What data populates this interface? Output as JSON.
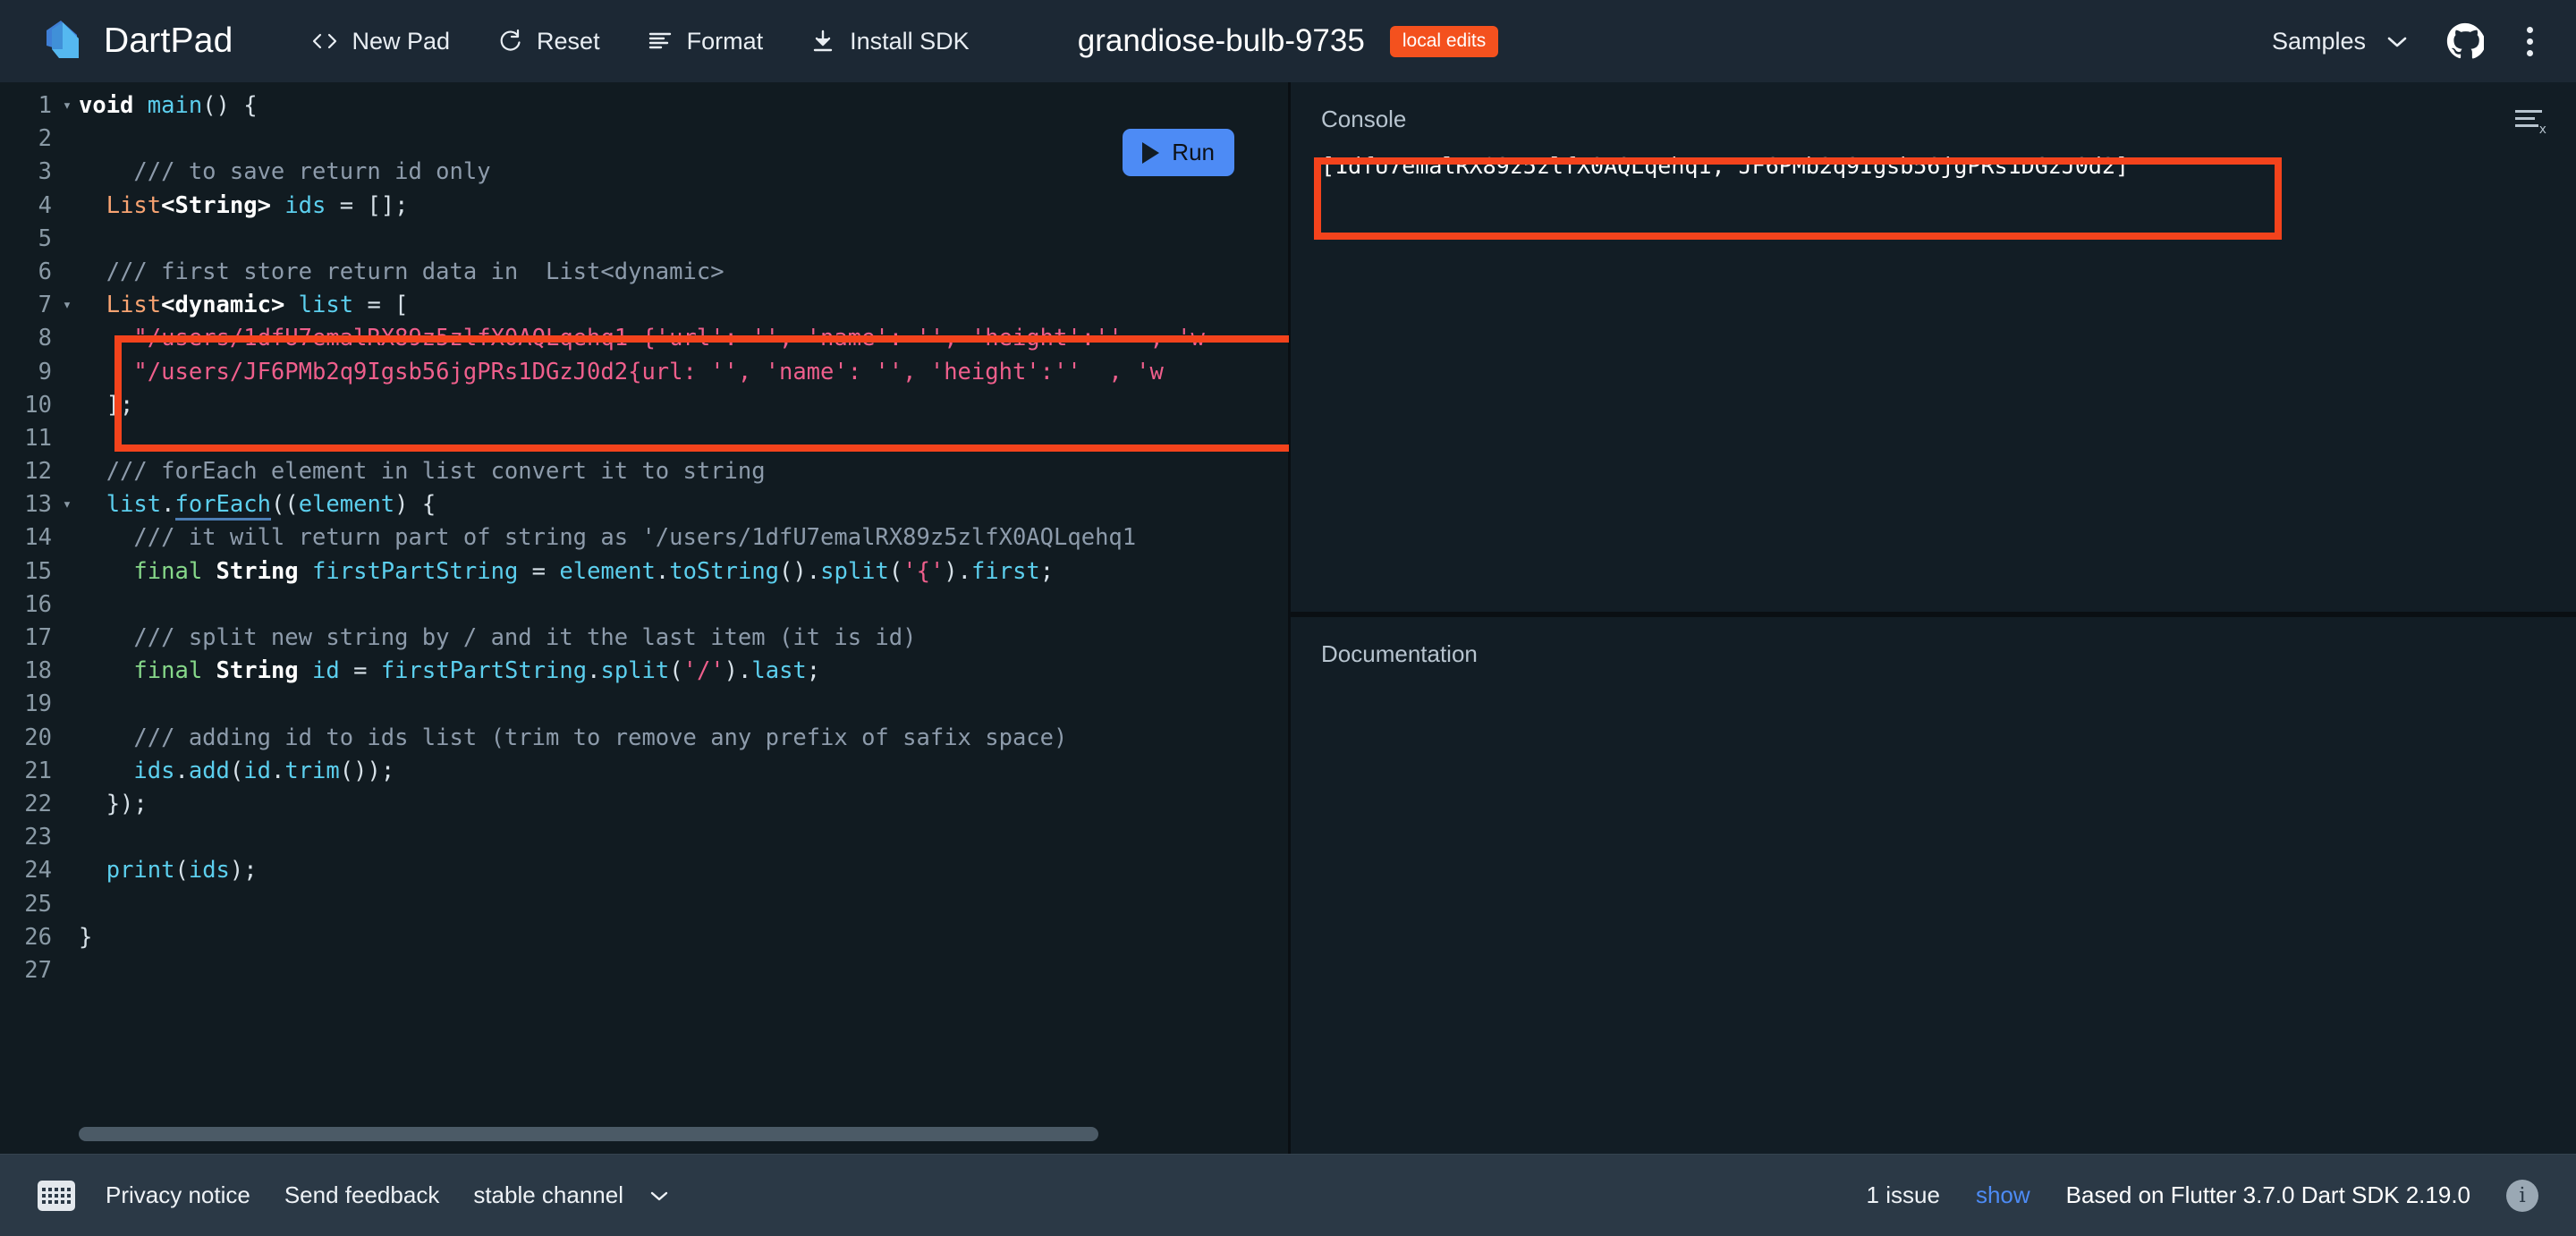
{
  "header": {
    "brand": "DartPad",
    "actions": [
      {
        "label": "New Pad",
        "icon": "code-brackets-icon"
      },
      {
        "label": "Reset",
        "icon": "reset-icon"
      },
      {
        "label": "Format",
        "icon": "format-lines-icon"
      },
      {
        "label": "Install SDK",
        "icon": "download-icon"
      }
    ],
    "pad_title": "grandiose-bulb-9735",
    "badge": "local edits",
    "samples_label": "Samples",
    "github_icon": "github-icon",
    "more_icon": "kebab-menu-icon"
  },
  "editor": {
    "run_label": "Run",
    "lines": [
      {
        "n": "1",
        "fold": "▾",
        "tokens": [
          {
            "t": "kw",
            "s": "void"
          },
          {
            "t": "punc",
            "s": " "
          },
          {
            "t": "ident",
            "s": "main"
          },
          {
            "t": "punc",
            "s": "() {"
          }
        ]
      },
      {
        "n": "2",
        "fold": "",
        "tokens": []
      },
      {
        "n": "3",
        "fold": "",
        "tokens": [
          {
            "t": "cmt",
            "s": "    /// to save return id only"
          }
        ]
      },
      {
        "n": "4",
        "fold": "",
        "tokens": [
          {
            "t": "punc",
            "s": "  "
          },
          {
            "t": "type",
            "s": "List"
          },
          {
            "t": "typew",
            "s": "<String>"
          },
          {
            "t": "punc",
            "s": " "
          },
          {
            "t": "var",
            "s": "ids"
          },
          {
            "t": "punc",
            "s": " = [];"
          }
        ]
      },
      {
        "n": "5",
        "fold": "",
        "tokens": []
      },
      {
        "n": "6",
        "fold": "",
        "tokens": [
          {
            "t": "cmt",
            "s": "  /// first store return data in  List<dynamic>"
          }
        ]
      },
      {
        "n": "7",
        "fold": "▾",
        "tokens": [
          {
            "t": "punc",
            "s": "  "
          },
          {
            "t": "type",
            "s": "List"
          },
          {
            "t": "typew",
            "s": "<dynamic>"
          },
          {
            "t": "punc",
            "s": " "
          },
          {
            "t": "var",
            "s": "list"
          },
          {
            "t": "punc",
            "s": " = ["
          }
        ]
      },
      {
        "n": "8",
        "fold": "",
        "tokens": [
          {
            "t": "str",
            "s": "    \"/users/1dfU7emalRX89z5zlfX0AQLqehq1 {'url': '', 'name': '', 'height':''  , 'w"
          }
        ]
      },
      {
        "n": "9",
        "fold": "",
        "tokens": [
          {
            "t": "str",
            "s": "    \"/users/JF6PMb2q9Igsb56jgPRs1DGzJ0d2{url: '', 'name': '', 'height':''  , 'w"
          }
        ]
      },
      {
        "n": "10",
        "fold": "",
        "tokens": [
          {
            "t": "punc",
            "s": "  ];"
          }
        ]
      },
      {
        "n": "11",
        "fold": "",
        "tokens": []
      },
      {
        "n": "12",
        "fold": "",
        "tokens": [
          {
            "t": "cmt",
            "s": "  /// forEach element in list convert it to string"
          }
        ]
      },
      {
        "n": "13",
        "fold": "▾",
        "tokens": [
          {
            "t": "punc",
            "s": "  "
          },
          {
            "t": "var",
            "s": "list"
          },
          {
            "t": "punc",
            "s": "."
          },
          {
            "t": "link",
            "s": "forEach"
          },
          {
            "t": "punc",
            "s": "(("
          },
          {
            "t": "var",
            "s": "element"
          },
          {
            "t": "punc",
            "s": ") {"
          }
        ]
      },
      {
        "n": "14",
        "fold": "",
        "tokens": [
          {
            "t": "cmt",
            "s": "    /// it will return part of string as '/users/1dfU7emalRX89z5zlfX0AQLqehq1"
          }
        ]
      },
      {
        "n": "15",
        "fold": "",
        "tokens": [
          {
            "t": "punc",
            "s": "    "
          },
          {
            "t": "final",
            "s": "final"
          },
          {
            "t": "punc",
            "s": " "
          },
          {
            "t": "typew",
            "s": "String"
          },
          {
            "t": "punc",
            "s": " "
          },
          {
            "t": "var",
            "s": "firstPartString"
          },
          {
            "t": "punc",
            "s": " = "
          },
          {
            "t": "var",
            "s": "element"
          },
          {
            "t": "punc",
            "s": "."
          },
          {
            "t": "ident",
            "s": "toString"
          },
          {
            "t": "punc",
            "s": "()."
          },
          {
            "t": "ident",
            "s": "split"
          },
          {
            "t": "punc",
            "s": "("
          },
          {
            "t": "str",
            "s": "'{'"
          },
          {
            "t": "punc",
            "s": ")."
          },
          {
            "t": "ident",
            "s": "first"
          },
          {
            "t": "punc",
            "s": ";"
          }
        ]
      },
      {
        "n": "16",
        "fold": "",
        "tokens": []
      },
      {
        "n": "17",
        "fold": "",
        "tokens": [
          {
            "t": "cmt",
            "s": "    /// split new string by / and it the last item (it is id)"
          }
        ]
      },
      {
        "n": "18",
        "fold": "",
        "tokens": [
          {
            "t": "punc",
            "s": "    "
          },
          {
            "t": "final",
            "s": "final"
          },
          {
            "t": "punc",
            "s": " "
          },
          {
            "t": "typew",
            "s": "String"
          },
          {
            "t": "punc",
            "s": " "
          },
          {
            "t": "var",
            "s": "id"
          },
          {
            "t": "punc",
            "s": " = "
          },
          {
            "t": "var",
            "s": "firstPartString"
          },
          {
            "t": "punc",
            "s": "."
          },
          {
            "t": "ident",
            "s": "split"
          },
          {
            "t": "punc",
            "s": "("
          },
          {
            "t": "str",
            "s": "'/'"
          },
          {
            "t": "punc",
            "s": ")."
          },
          {
            "t": "ident",
            "s": "last"
          },
          {
            "t": "punc",
            "s": ";"
          }
        ]
      },
      {
        "n": "19",
        "fold": "",
        "tokens": []
      },
      {
        "n": "20",
        "fold": "",
        "tokens": [
          {
            "t": "cmt",
            "s": "    /// adding id to ids list (trim to remove any prefix of safix space)"
          }
        ]
      },
      {
        "n": "21",
        "fold": "",
        "tokens": [
          {
            "t": "punc",
            "s": "    "
          },
          {
            "t": "var",
            "s": "ids"
          },
          {
            "t": "punc",
            "s": "."
          },
          {
            "t": "ident",
            "s": "add"
          },
          {
            "t": "punc",
            "s": "("
          },
          {
            "t": "var",
            "s": "id"
          },
          {
            "t": "punc",
            "s": "."
          },
          {
            "t": "ident",
            "s": "trim"
          },
          {
            "t": "punc",
            "s": "());"
          }
        ]
      },
      {
        "n": "22",
        "fold": "",
        "tokens": [
          {
            "t": "punc",
            "s": "  });"
          }
        ]
      },
      {
        "n": "23",
        "fold": "",
        "tokens": []
      },
      {
        "n": "24",
        "fold": "",
        "tokens": [
          {
            "t": "punc",
            "s": "  "
          },
          {
            "t": "ident",
            "s": "print"
          },
          {
            "t": "punc",
            "s": "("
          },
          {
            "t": "var",
            "s": "ids"
          },
          {
            "t": "punc",
            "s": ");"
          }
        ]
      },
      {
        "n": "25",
        "fold": "",
        "tokens": []
      },
      {
        "n": "26",
        "fold": "",
        "tokens": [
          {
            "t": "punc",
            "s": "}"
          }
        ]
      },
      {
        "n": "27",
        "fold": "",
        "tokens": []
      }
    ]
  },
  "console": {
    "title": "Console",
    "clear_icon": "clear-console-icon",
    "output": "[1dfU7emalRX89z5zlfX0AQLqehq1, JF6PMb2q9Igsb56jgPRs1DGzJ0d2]"
  },
  "documentation": {
    "title": "Documentation"
  },
  "footer": {
    "keyboard_icon": "keyboard-icon",
    "privacy": "Privacy notice",
    "feedback": "Send feedback",
    "channel": "stable channel",
    "issues": "1 issue",
    "show": "show",
    "version": "Based on Flutter 3.7.0 Dart SDK 2.19.0",
    "info_icon": "info-icon"
  },
  "colors": {
    "accent_blue": "#4d8bf5",
    "badge_orange": "#f4511e",
    "highlight_red": "#f4431c",
    "header_bg": "#1c2834",
    "editor_bg": "#111b21",
    "panel_bg": "#121d25",
    "footer_bg": "#2b3946"
  }
}
